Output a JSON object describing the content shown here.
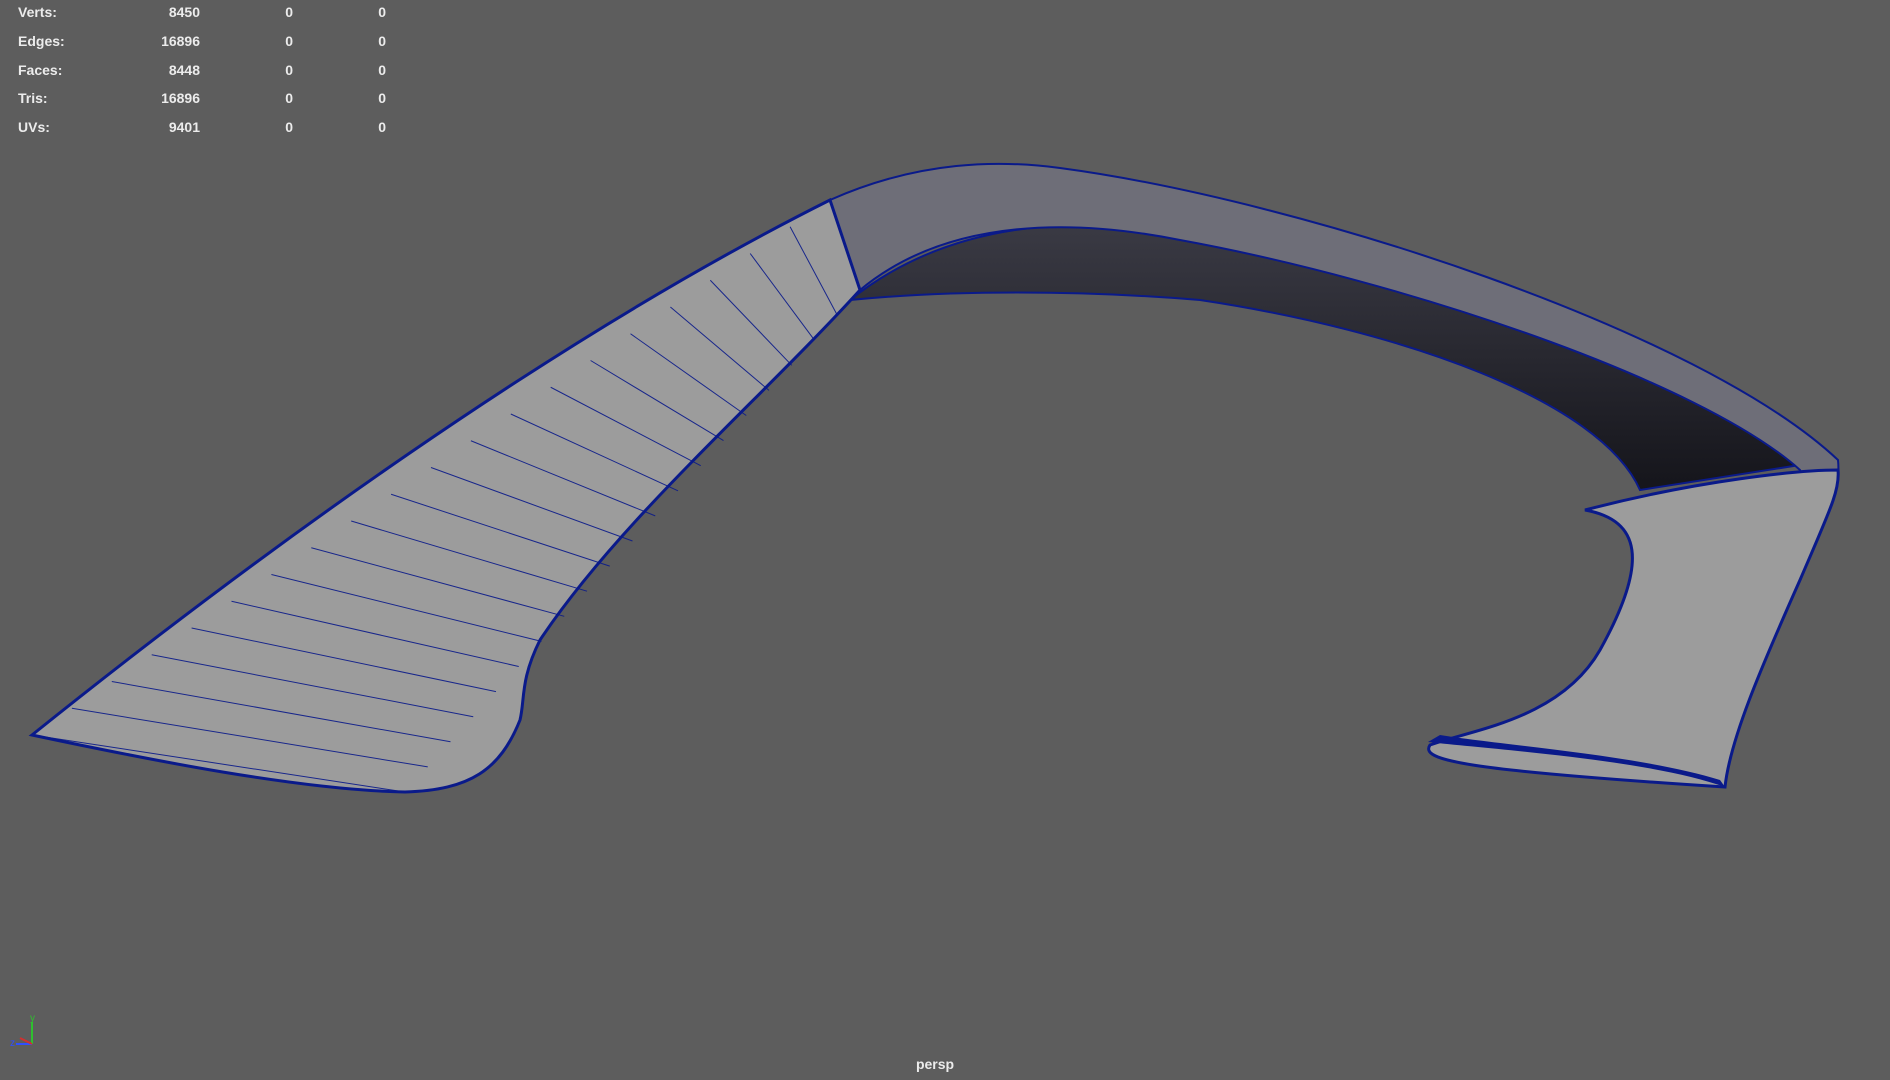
{
  "hud": {
    "rows": [
      {
        "label": "Verts:",
        "values": [
          "8450",
          "0",
          "0"
        ]
      },
      {
        "label": "Edges:",
        "values": [
          "16896",
          "0",
          "0"
        ]
      },
      {
        "label": "Faces:",
        "values": [
          "8448",
          "0",
          "0"
        ]
      },
      {
        "label": "Tris:",
        "values": [
          "16896",
          "0",
          "0"
        ]
      },
      {
        "label": "UVs:",
        "values": [
          "9401",
          "0",
          "0"
        ]
      }
    ]
  },
  "camera": {
    "label": "persp"
  },
  "axis_gizmo": {
    "y_label": "y",
    "z_label": "z"
  },
  "colors": {
    "background": "#5d5d5d",
    "wire": "#0a1a8a",
    "surface_light": "#9c9c9c",
    "surface_dark": "#1c1c24",
    "hud_text": "#ececec",
    "axis_y": "#2fbf2f",
    "axis_z": "#2f4fff",
    "axis_x": "#d03030"
  },
  "mesh": {
    "icon": "wireframe-spoiler-mesh"
  }
}
